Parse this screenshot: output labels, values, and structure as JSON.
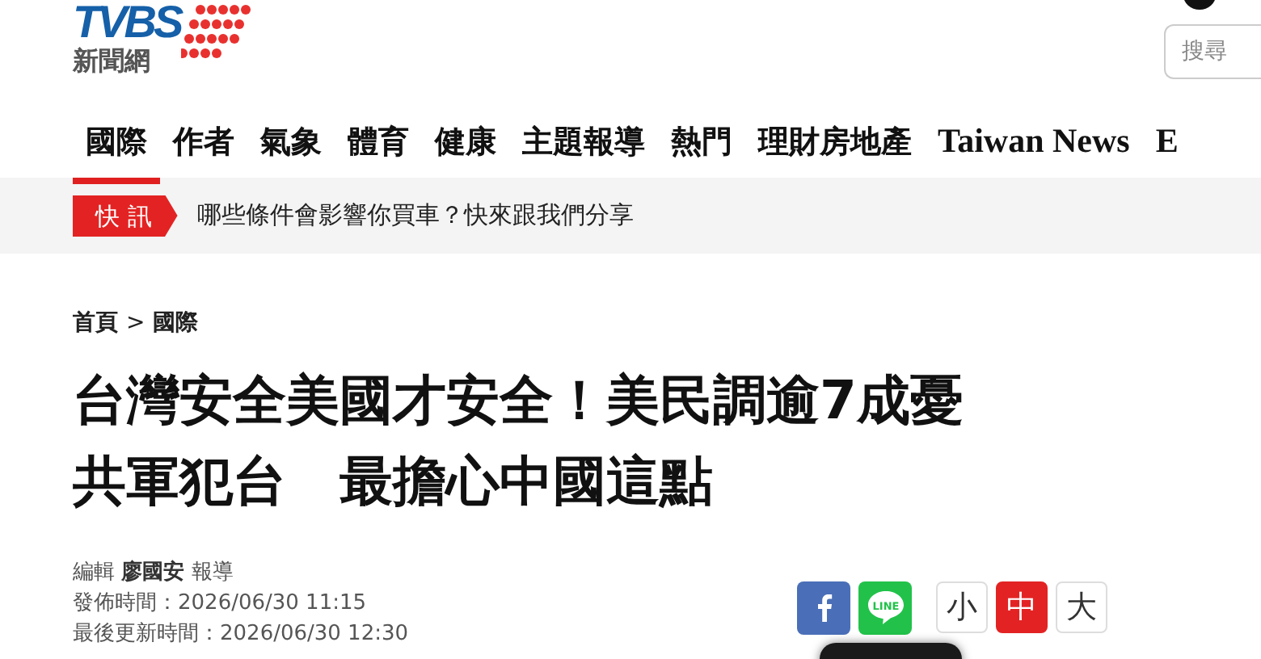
{
  "logo": {
    "wordmark": "TVBS",
    "subtitle": "新聞網"
  },
  "search": {
    "placeholder": "搜尋"
  },
  "nav": [
    {
      "label": "國際",
      "selected": true,
      "kind": "zh"
    },
    {
      "label": "作者",
      "selected": false,
      "kind": "zh"
    },
    {
      "label": "氣象",
      "selected": false,
      "kind": "zh"
    },
    {
      "label": "體育",
      "selected": false,
      "kind": "zh"
    },
    {
      "label": "健康",
      "selected": false,
      "kind": "zh"
    },
    {
      "label": "主題報導",
      "selected": false,
      "kind": "zh"
    },
    {
      "label": "熱門",
      "selected": false,
      "kind": "zh"
    },
    {
      "label": "理財房地產",
      "selected": false,
      "kind": "zh"
    },
    {
      "label": "Taiwan News",
      "selected": false,
      "kind": "en"
    },
    {
      "label": "E",
      "selected": false,
      "kind": "en"
    }
  ],
  "ticker": {
    "badge": "快 訊",
    "text": "哪些條件會影響你買車？快來跟我們分享"
  },
  "breadcrumb": [
    {
      "label": "首頁"
    },
    {
      "label": "國際"
    }
  ],
  "breadcrumb_separator": ">",
  "headline": [
    "台灣安全美國才安全！美民調逾7成憂",
    "共軍犯台　最擔心中國這點"
  ],
  "meta": {
    "editor_label": "編輯",
    "editor": "廖國安",
    "editor_suffix": "報導",
    "published": "發佈時間：2026/06/30 11:15",
    "updated": "最後更新時間：2026/06/30 12:30"
  },
  "share": [
    {
      "kind": "facebook"
    },
    {
      "kind": "line",
      "label": "LINE"
    }
  ],
  "font_sizes": [
    {
      "label": "小",
      "selected": false
    },
    {
      "label": "中",
      "selected": true
    },
    {
      "label": "大",
      "selected": false
    }
  ]
}
